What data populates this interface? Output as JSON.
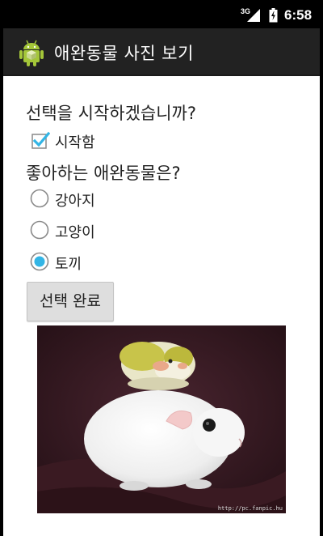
{
  "status_bar": {
    "network": "3G",
    "time": "6:58"
  },
  "action_bar": {
    "title": "애완동물 사진 보기",
    "icon": "android-icon"
  },
  "form": {
    "start_question": "선택을 시작하겠습니까?",
    "start_checkbox": {
      "label": "시작함",
      "checked": true
    },
    "pet_question": "좋아하는 애완동물은?",
    "pet_options": [
      {
        "label": "강아지",
        "selected": false
      },
      {
        "label": "고양이",
        "selected": false
      },
      {
        "label": "토끼",
        "selected": true
      }
    ],
    "submit_label": "선택 완료"
  },
  "image": {
    "watermark": "http://pc.fanpic.hu"
  },
  "colors": {
    "accent": "#33b5e5",
    "action_bar": "#222222",
    "status_bar": "#000000",
    "content_bg": "#ffffff"
  }
}
